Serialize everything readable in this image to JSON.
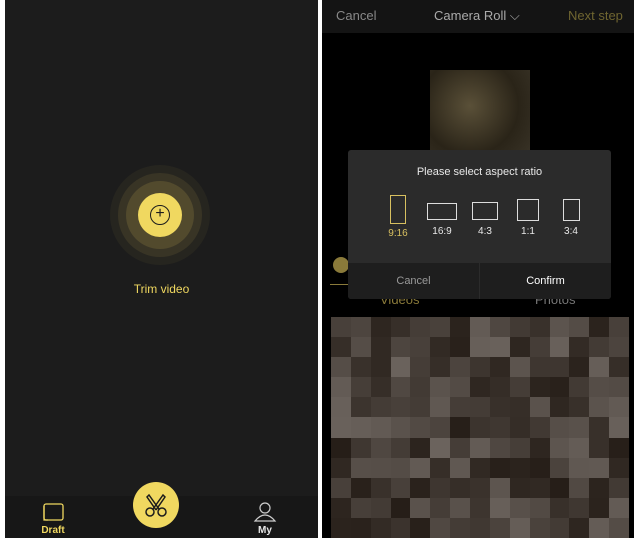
{
  "left": {
    "action_label": "Trim video",
    "nav": [
      {
        "label": "Draft",
        "icon": "draft-book-icon"
      },
      {
        "label": "My",
        "icon": "person-icon"
      }
    ],
    "center_icon": "scissors-icon"
  },
  "right": {
    "header": {
      "cancel": "Cancel",
      "title": "Camera Roll",
      "next": "Next step"
    },
    "dialog": {
      "title": "Please select aspect ratio",
      "ratios": [
        "9:16",
        "16:9",
        "4:3",
        "1:1",
        "3:4"
      ],
      "selected": "9:16",
      "cancel": "Cancel",
      "confirm": "Confirm"
    },
    "tabs": [
      "Videos",
      "Photos"
    ],
    "active_tab": "Videos"
  },
  "colors": {
    "accent": "#f0d860"
  }
}
